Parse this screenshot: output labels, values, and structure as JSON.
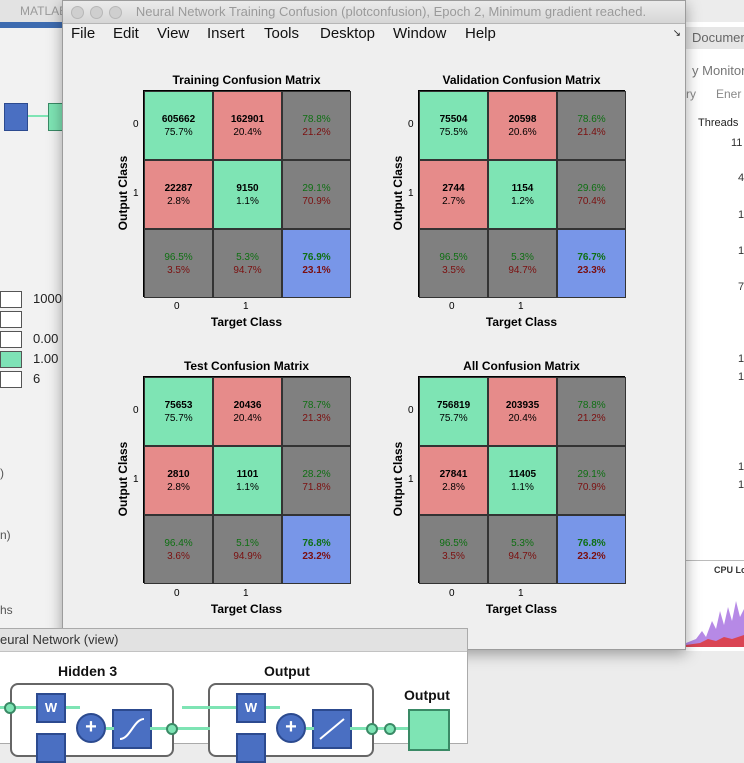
{
  "background": {
    "left_window_title": "MATLAB",
    "left_fields": [
      {
        "value": "1000"
      },
      {
        "value": ""
      },
      {
        "value": "0.00"
      },
      {
        "value": "1.00"
      },
      {
        "value": "6"
      }
    ],
    "left_edge_chars": [
      ")",
      "n)",
      "hs"
    ],
    "right_window_title": "Documen",
    "right_header": "y Monitor",
    "right_subheader": [
      "ry",
      "Ener"
    ],
    "right_col_header": "Threads",
    "right_col_values": [
      "11",
      "4",
      "1",
      "1",
      "7",
      "1",
      "1",
      "1",
      "1"
    ],
    "cpu_label": "CPU Lo"
  },
  "figure": {
    "title": "Neural Network Training Confusion (plotconfusion), Epoch 2, Minimum gradient reached.",
    "menu": [
      "File",
      "Edit",
      "View",
      "Insert",
      "Tools",
      "Desktop",
      "Window",
      "Help"
    ],
    "axis_x_label": "Target Class",
    "axis_y_label": "Output Class",
    "tick_labels": [
      "0",
      "1"
    ],
    "matrices": [
      {
        "title": "Training Confusion Matrix",
        "cells": [
          [
            "605662",
            "75.7%"
          ],
          [
            "162901",
            "20.4%"
          ],
          [
            "78.8%",
            "21.2%"
          ],
          [
            "22287",
            "2.8%"
          ],
          [
            "9150",
            "1.1%"
          ],
          [
            "29.1%",
            "70.9%"
          ],
          [
            "96.5%",
            "3.5%"
          ],
          [
            "5.3%",
            "94.7%"
          ],
          [
            "76.9%",
            "23.1%"
          ]
        ]
      },
      {
        "title": "Validation Confusion Matrix",
        "cells": [
          [
            "75504",
            "75.5%"
          ],
          [
            "20598",
            "20.6%"
          ],
          [
            "78.6%",
            "21.4%"
          ],
          [
            "2744",
            "2.7%"
          ],
          [
            "1154",
            "1.2%"
          ],
          [
            "29.6%",
            "70.4%"
          ],
          [
            "96.5%",
            "3.5%"
          ],
          [
            "5.3%",
            "94.7%"
          ],
          [
            "76.7%",
            "23.3%"
          ]
        ]
      },
      {
        "title": "Test Confusion Matrix",
        "cells": [
          [
            "75653",
            "75.7%"
          ],
          [
            "20436",
            "20.4%"
          ],
          [
            "78.7%",
            "21.3%"
          ],
          [
            "2810",
            "2.8%"
          ],
          [
            "1101",
            "1.1%"
          ],
          [
            "28.2%",
            "71.8%"
          ],
          [
            "96.4%",
            "3.6%"
          ],
          [
            "5.1%",
            "94.9%"
          ],
          [
            "76.8%",
            "23.2%"
          ]
        ]
      },
      {
        "title": "All Confusion Matrix",
        "cells": [
          [
            "756819",
            "75.7%"
          ],
          [
            "203935",
            "20.4%"
          ],
          [
            "78.8%",
            "21.2%"
          ],
          [
            "27841",
            "2.8%"
          ],
          [
            "11405",
            "1.1%"
          ],
          [
            "29.1%",
            "70.9%"
          ],
          [
            "96.5%",
            "3.5%"
          ],
          [
            "5.3%",
            "94.7%"
          ],
          [
            "76.8%",
            "23.2%"
          ]
        ]
      }
    ]
  },
  "nn_view": {
    "title": "eural Network (view)",
    "layer_hidden": "Hidden 3",
    "layer_output": "Output",
    "output_label": "Output",
    "w_label": "W",
    "plus_label": "+"
  }
}
